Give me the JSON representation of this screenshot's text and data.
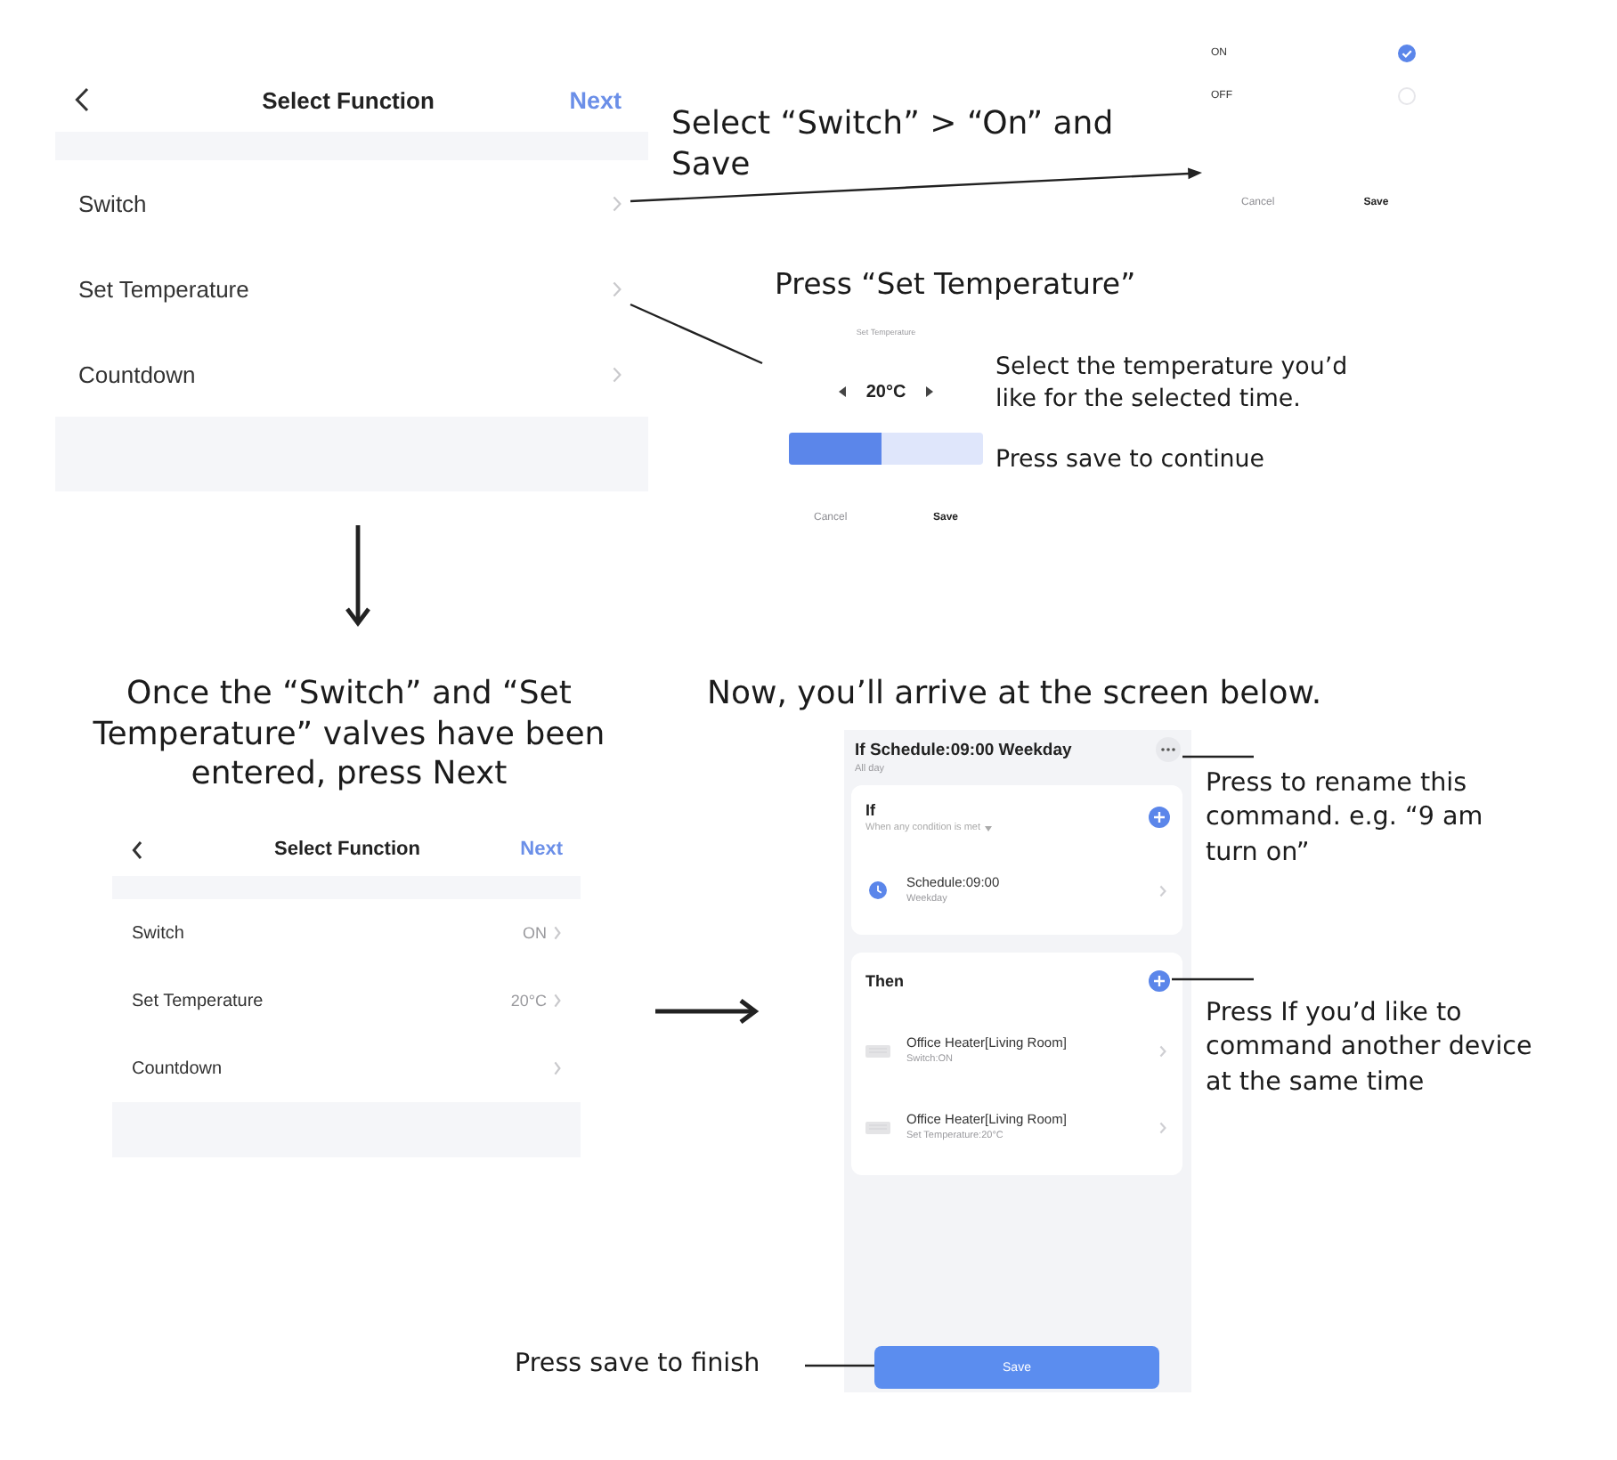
{
  "select_function_screen": {
    "title": "Select Function",
    "action": "Next",
    "rows": [
      {
        "label": "Switch"
      },
      {
        "label": "Set Temperature"
      },
      {
        "label": "Countdown"
      }
    ]
  },
  "switch_note": "Select “Switch” > “On” and Save",
  "switch_dialog": {
    "options": [
      {
        "label": "ON",
        "selected": true
      },
      {
        "label": "OFF",
        "selected": false
      }
    ],
    "buttons": [
      "Cancel",
      "Save"
    ]
  },
  "temperature_note": "Press “Set Temperature”",
  "temperature_dialog": {
    "title": "Set Temperature",
    "value": "20°C",
    "level": 0.48,
    "buttons": [
      "Cancel",
      "Save"
    ]
  },
  "temperature_notes": [
    "Select the temperature you’d like for the selected time.",
    "Press save to continue"
  ],
  "next_note": "Once the “Switch” and “Set Temperature” valves have been entered, press Next",
  "filled_screen": {
    "title": "Select Function",
    "action": "Next",
    "rows": [
      {
        "label": "Switch",
        "value": "ON"
      },
      {
        "label": "Set Temperature",
        "value": "20°C"
      },
      {
        "label": "Countdown"
      }
    ]
  },
  "arrive_note": "Now, you’ll arrive at the screen below.",
  "scene_screen": {
    "title": "If Schedule:09:00 Weekday",
    "subtitle": "All day",
    "if_card": {
      "title": "If",
      "subtitle": "When any condition is met",
      "conditions": [
        {
          "title": "Schedule:09:00",
          "detail": "Weekday"
        }
      ]
    },
    "then_card": {
      "title": "Then",
      "actions": [
        {
          "title": "Office Heater[Living Room]",
          "detail": "Switch:ON"
        },
        {
          "title": "Office Heater[Living Room]",
          "detail": "Set Temperature:20°C"
        }
      ]
    },
    "button": "Save"
  },
  "callouts": [
    "Press to rename this command. e.g. “9 am turn on”",
    "Press If you’d like to command another device at the same time",
    "Press save to finish"
  ]
}
